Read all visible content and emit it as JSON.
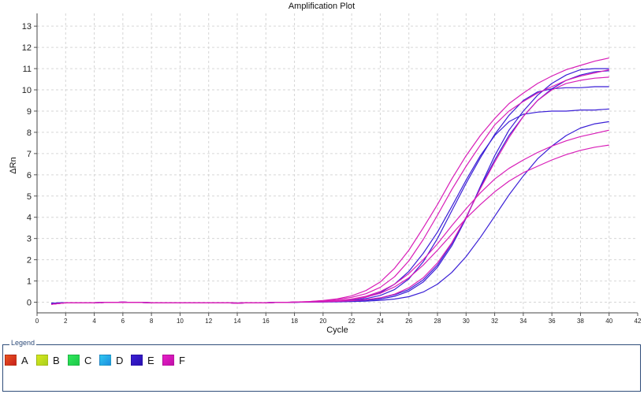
{
  "chart_data": {
    "type": "line",
    "title": "Amplification Plot",
    "xlabel": "Cycle",
    "ylabel": "ΔRn",
    "xlim": [
      0,
      42
    ],
    "ylim": [
      -0.5,
      13.6
    ],
    "xticks": [
      0,
      2,
      4,
      6,
      8,
      10,
      12,
      14,
      16,
      18,
      20,
      22,
      24,
      26,
      28,
      30,
      32,
      34,
      36,
      38,
      40,
      42
    ],
    "yticks": [
      0,
      1,
      2,
      3,
      4,
      5,
      6,
      7,
      8,
      9,
      10,
      11,
      12,
      13
    ],
    "grid": true,
    "x": [
      1,
      2,
      3,
      4,
      5,
      6,
      7,
      8,
      9,
      10,
      11,
      12,
      13,
      14,
      15,
      16,
      17,
      18,
      19,
      20,
      21,
      22,
      23,
      24,
      25,
      26,
      27,
      28,
      29,
      30,
      31,
      32,
      33,
      34,
      35,
      36,
      37,
      38,
      39,
      40
    ],
    "series": [
      {
        "group": "E",
        "color": "#3a1fd6",
        "values": [
          -0.05,
          -0.02,
          -0.02,
          -0.02,
          -0.01,
          0.0,
          -0.01,
          -0.02,
          -0.02,
          -0.02,
          -0.02,
          -0.02,
          -0.02,
          -0.04,
          -0.02,
          -0.02,
          -0.01,
          0.0,
          0.01,
          0.02,
          0.04,
          0.07,
          0.12,
          0.2,
          0.35,
          0.6,
          1.05,
          1.75,
          2.75,
          4.0,
          5.4,
          6.7,
          7.85,
          8.75,
          9.5,
          10.05,
          10.45,
          10.7,
          10.85,
          10.9
        ]
      },
      {
        "group": "E",
        "color": "#3a1fd6",
        "values": [
          -0.05,
          -0.02,
          -0.02,
          -0.02,
          -0.01,
          0.0,
          -0.01,
          -0.02,
          -0.02,
          -0.02,
          -0.02,
          -0.02,
          -0.02,
          -0.04,
          -0.02,
          -0.02,
          -0.01,
          0.0,
          0.01,
          0.02,
          0.03,
          0.05,
          0.09,
          0.15,
          0.28,
          0.52,
          0.95,
          1.65,
          2.65,
          3.95,
          5.45,
          6.9,
          8.1,
          9.0,
          9.75,
          10.3,
          10.7,
          10.95,
          11.0,
          11.0
        ]
      },
      {
        "group": "E",
        "color": "#3a1fd6",
        "values": [
          -0.05,
          -0.02,
          -0.02,
          -0.02,
          -0.01,
          0.0,
          -0.01,
          -0.02,
          -0.02,
          -0.02,
          -0.02,
          -0.02,
          -0.02,
          -0.04,
          -0.02,
          -0.02,
          -0.01,
          0.0,
          0.01,
          0.03,
          0.05,
          0.09,
          0.17,
          0.32,
          0.6,
          1.1,
          1.9,
          3.0,
          4.3,
          5.6,
          6.8,
          7.9,
          8.8,
          9.5,
          9.9,
          10.05,
          10.1,
          10.1,
          10.15,
          10.15
        ]
      },
      {
        "group": "E",
        "color": "#3a1fd6",
        "values": [
          -0.05,
          -0.02,
          -0.02,
          -0.02,
          -0.01,
          0.0,
          -0.01,
          -0.02,
          -0.02,
          -0.02,
          -0.02,
          -0.02,
          -0.02,
          -0.04,
          -0.02,
          -0.02,
          -0.01,
          0.0,
          0.01,
          0.03,
          0.06,
          0.12,
          0.24,
          0.45,
          0.85,
          1.45,
          2.3,
          3.3,
          4.5,
          5.75,
          6.9,
          7.85,
          8.5,
          8.85,
          8.95,
          9.0,
          9.0,
          9.05,
          9.05,
          9.1
        ]
      },
      {
        "group": "E",
        "color": "#3a1fd6",
        "values": [
          -0.05,
          -0.02,
          -0.02,
          -0.02,
          -0.01,
          0.0,
          -0.01,
          -0.02,
          -0.02,
          -0.02,
          -0.02,
          -0.02,
          -0.02,
          -0.04,
          -0.02,
          -0.02,
          -0.01,
          0.0,
          0.0,
          0.01,
          0.02,
          0.03,
          0.05,
          0.09,
          0.15,
          0.26,
          0.48,
          0.85,
          1.4,
          2.15,
          3.05,
          4.05,
          5.05,
          5.95,
          6.75,
          7.35,
          7.85,
          8.2,
          8.4,
          8.5
        ]
      },
      {
        "group": "F",
        "color": "#d81eb8",
        "values": [
          -0.1,
          -0.03,
          -0.02,
          -0.02,
          -0.01,
          0.0,
          -0.01,
          -0.02,
          -0.02,
          -0.02,
          -0.02,
          -0.02,
          -0.02,
          -0.04,
          -0.02,
          -0.02,
          -0.01,
          0.01,
          0.03,
          0.08,
          0.16,
          0.3,
          0.55,
          0.95,
          1.6,
          2.45,
          3.5,
          4.6,
          5.8,
          6.9,
          7.85,
          8.65,
          9.35,
          9.85,
          10.3,
          10.65,
          10.95,
          11.15,
          11.35,
          11.5
        ]
      },
      {
        "group": "F",
        "color": "#d81eb8",
        "values": [
          -0.1,
          -0.03,
          -0.02,
          -0.02,
          -0.01,
          0.0,
          -0.01,
          -0.02,
          -0.02,
          -0.02,
          -0.02,
          -0.02,
          -0.02,
          -0.04,
          -0.02,
          -0.02,
          -0.01,
          0.01,
          0.03,
          0.07,
          0.13,
          0.23,
          0.4,
          0.7,
          1.2,
          1.95,
          2.95,
          4.1,
          5.3,
          6.4,
          7.4,
          8.35,
          9.0,
          9.45,
          9.85,
          10.15,
          10.45,
          10.65,
          10.8,
          10.95
        ]
      },
      {
        "group": "F",
        "color": "#d81eb8",
        "values": [
          -0.1,
          -0.03,
          -0.02,
          -0.02,
          -0.01,
          0.0,
          -0.01,
          -0.02,
          -0.02,
          -0.02,
          -0.02,
          -0.02,
          -0.02,
          -0.04,
          -0.02,
          -0.02,
          -0.01,
          0.0,
          0.01,
          0.02,
          0.04,
          0.07,
          0.12,
          0.21,
          0.38,
          0.68,
          1.15,
          1.85,
          2.8,
          4.0,
          5.35,
          6.6,
          7.75,
          8.75,
          9.5,
          10.0,
          10.3,
          10.45,
          10.55,
          10.6
        ]
      },
      {
        "group": "F",
        "color": "#d81eb8",
        "values": [
          -0.1,
          -0.03,
          -0.02,
          -0.02,
          -0.01,
          0.0,
          -0.01,
          -0.02,
          -0.02,
          -0.02,
          -0.02,
          -0.02,
          -0.02,
          -0.04,
          -0.02,
          -0.02,
          -0.01,
          0.0,
          0.02,
          0.04,
          0.08,
          0.15,
          0.28,
          0.5,
          0.85,
          1.35,
          2.0,
          2.75,
          3.6,
          4.4,
          5.15,
          5.8,
          6.3,
          6.7,
          7.05,
          7.35,
          7.6,
          7.8,
          7.95,
          8.1
        ]
      },
      {
        "group": "F",
        "color": "#d81eb8",
        "values": [
          -0.1,
          -0.03,
          -0.02,
          -0.02,
          -0.01,
          0.0,
          -0.01,
          -0.02,
          -0.02,
          -0.02,
          -0.02,
          -0.02,
          -0.02,
          -0.04,
          -0.02,
          -0.02,
          -0.01,
          0.0,
          0.02,
          0.04,
          0.07,
          0.13,
          0.24,
          0.42,
          0.72,
          1.15,
          1.75,
          2.45,
          3.2,
          3.95,
          4.6,
          5.2,
          5.7,
          6.1,
          6.4,
          6.7,
          6.95,
          7.15,
          7.3,
          7.4
        ]
      }
    ]
  },
  "legend": {
    "title": "Legend",
    "items": [
      {
        "label": "A",
        "color": "#e8541c",
        "color2": "#c8201e"
      },
      {
        "label": "B",
        "color": "#d8e81c",
        "color2": "#a8d01e"
      },
      {
        "label": "C",
        "color": "#2ee85a",
        "color2": "#1ec84a"
      },
      {
        "label": "D",
        "color": "#2ec8f0",
        "color2": "#1e8ee0"
      },
      {
        "label": "E",
        "color": "#3a1fd6",
        "color2": "#2a10b0"
      },
      {
        "label": "F",
        "color": "#e81ec8",
        "color2": "#c010a8"
      }
    ]
  }
}
